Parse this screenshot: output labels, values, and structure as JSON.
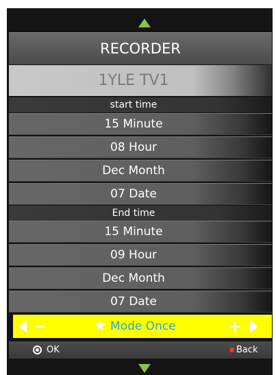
{
  "header": {
    "title": "RECORDER"
  },
  "channel": {
    "name": "1YLE TV1"
  },
  "start": {
    "label": "start time",
    "minute": "15 Minute",
    "hour": "08 Hour",
    "month": "Dec Month",
    "date": "07 Date"
  },
  "end": {
    "label": "End time",
    "minute": "15 Minute",
    "hour": "09 Hour",
    "month": "Dec Month",
    "date": "07 Date"
  },
  "mode": {
    "minus": "-",
    "plus": "+",
    "label": "Mode Once"
  },
  "footer": {
    "ok_label": "OK",
    "back_label": "Back"
  },
  "icons": {
    "up": "arrow-up-icon",
    "down": "arrow-down-icon",
    "left": "arrow-left-icon",
    "right": "arrow-right-icon",
    "star": "star-icon",
    "ok": "ok-button-icon",
    "back": "red-button-icon"
  },
  "colors": {
    "accent_green": "#8bc34a",
    "highlight_yellow": "#ffff00",
    "mode_text": "#29a8d6",
    "back_red": "#ff3030"
  }
}
